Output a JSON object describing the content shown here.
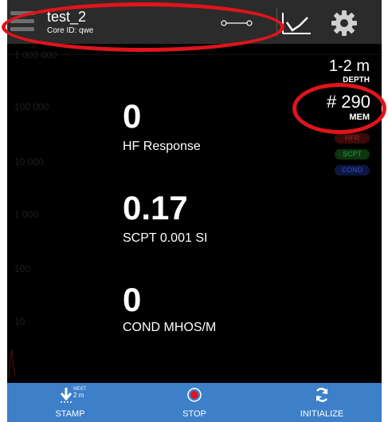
{
  "header": {
    "title": "test_2",
    "subtitle": "Core ID: qwe"
  },
  "axis": {
    "labels": [
      "1 000 000",
      "100 000",
      "10 000",
      "1 000",
      "100",
      "10"
    ]
  },
  "readings": [
    {
      "value": "0",
      "label": "HF Response"
    },
    {
      "value": "0.17",
      "label": "SCPT 0.001 SI"
    },
    {
      "value": "0",
      "label": "COND MHOS/M"
    }
  ],
  "side": {
    "depth_value": "1-2 m",
    "depth_label": "DEPTH",
    "mem_value": "# 290",
    "mem_label": "MEM",
    "badges": [
      "HFR",
      "SCPT",
      "COND"
    ]
  },
  "toolbar": {
    "stamp_label": "STAMP",
    "next_label": "NEXT",
    "next_value": "2 m",
    "stop_label": "STOP",
    "init_label": "INITIALIZE"
  },
  "colors": {
    "toolbar": "#3d7fc8",
    "header": "#2b2b2b",
    "annotation": "#e0141c",
    "stop_dot": "#e0141c"
  }
}
